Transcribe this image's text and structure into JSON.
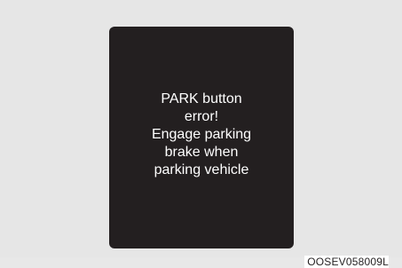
{
  "display": {
    "message": "PARK button\nerror!\nEngage parking\nbrake when\nparking vehicle"
  },
  "figure_code": "OOSEV058009L",
  "colors": {
    "background": "#e6e6e6",
    "display": "#231f20",
    "text": "#ffffff"
  }
}
